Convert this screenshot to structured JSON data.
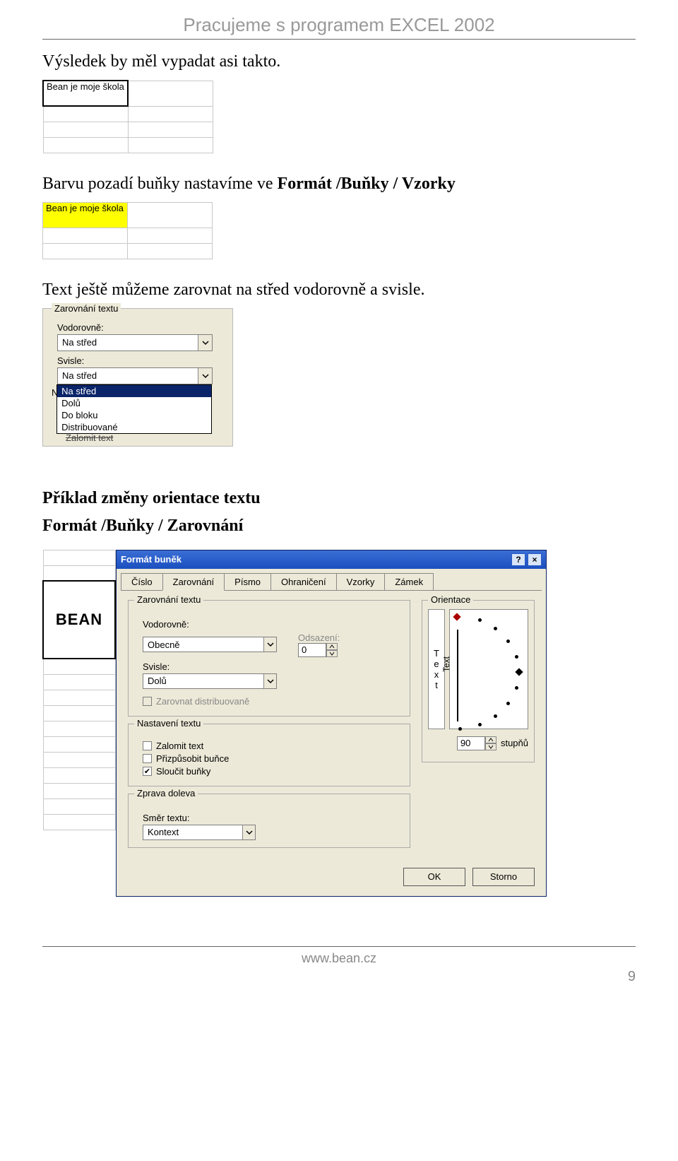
{
  "header": {
    "title": "Pracujeme s programem EXCEL 2002"
  },
  "text": {
    "t1": "Výsledek by měl vypadat asi takto.",
    "t2a": "Barvu pozadí buňky nastavíme ve ",
    "t2b": "Formát /Buňky / Vzorky",
    "t3": "Text ještě můžeme zarovnat na střed vodorovně a svisle.",
    "t4": "Příklad změny orientace textu",
    "t5": "Formát /Buňky / Zarovnání"
  },
  "snip1": {
    "cell": "Bean je moje škola"
  },
  "snip2": {
    "cell": "Bean je moje škola"
  },
  "alignGroup": {
    "groupLabel": "Zarovnání textu",
    "horizLabel": "Vodorovně:",
    "horizValue": "Na střed",
    "vertLabel": "Svisle:",
    "vertValue": "Na střed",
    "options": [
      "Na střed",
      "Dolů",
      "Do bloku",
      "Distribuované"
    ],
    "nas": "Nas",
    "truncated": "Zalomit text"
  },
  "dialog": {
    "beanCell": "BEAN",
    "title": "Formát buněk",
    "helpIcon": "?",
    "closeIcon": "×",
    "tabs": [
      "Číslo",
      "Zarovnání",
      "Písmo",
      "Ohraničení",
      "Vzorky",
      "Zámek"
    ],
    "activeTab": 1,
    "fs1Label": "Zarovnání textu",
    "horizLabel": "Vodorovně:",
    "horizValue": "Obecně",
    "odsazeniLabel": "Odsazení:",
    "odsazeniValue": "0",
    "vertLabel": "Svisle:",
    "vertValue": "Dolů",
    "distChk": "Zarovnat distribuovaně",
    "fs2Label": "Nastavení textu",
    "chk1": "Zalomit text",
    "chk2": "Přizpůsobit buňce",
    "chk3": "Sloučit buňky",
    "fs3Label": "Zprava doleva",
    "smerLabel": "Směr textu:",
    "smerValue": "Kontext",
    "orientLabel": "Orientace",
    "vertWord": "Text",
    "arcWord": "Text",
    "degreesValue": "90",
    "degreesLabel": "stupňů",
    "ok": "OK",
    "cancel": "Storno"
  },
  "footer": {
    "url": "www.bean.cz",
    "page": "9"
  }
}
